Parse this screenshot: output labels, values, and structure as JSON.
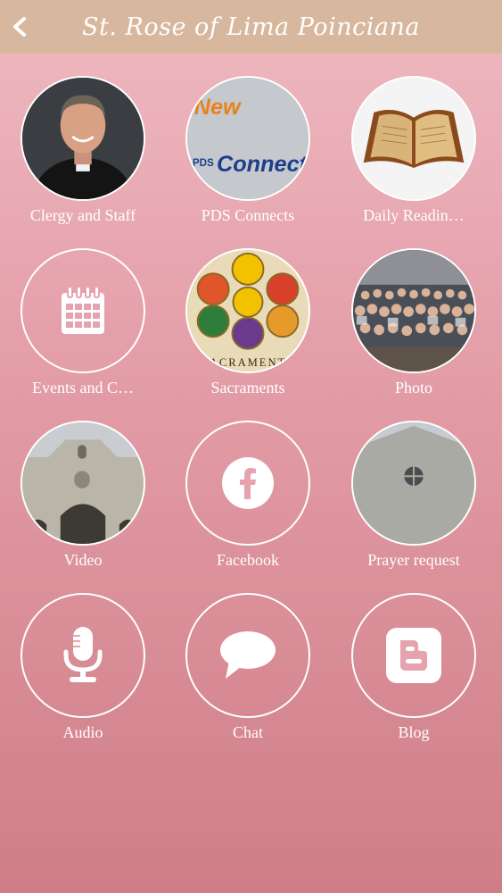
{
  "header": {
    "title": "St. Rose of Lima Poinciana",
    "back_icon": "chevron-left-icon"
  },
  "colors": {
    "header_bg": "#d7b79e",
    "bg_top": "#efb9c1",
    "bg_bottom": "#cf7e88",
    "text": "#ffffff"
  },
  "tiles": [
    {
      "label": "Clergy and Staff",
      "icon": "priest-photo"
    },
    {
      "label": "PDS Connects",
      "icon": "pds-connects-logo",
      "logo_text_1": "New",
      "logo_text_2": "PDS",
      "logo_text_3": "Connects"
    },
    {
      "label": "Daily Readin…",
      "icon": "open-bible-photo"
    },
    {
      "label": "Events and C…",
      "icon": "calendar-icon"
    },
    {
      "label": "Sacraments",
      "icon": "sacraments-image",
      "image_text": "SACRAMENTS"
    },
    {
      "label": "Photo",
      "icon": "congregation-photo"
    },
    {
      "label": "Video",
      "icon": "church-building-photo"
    },
    {
      "label": "Facebook",
      "icon": "facebook-icon"
    },
    {
      "label": "Prayer request",
      "icon": "church-wall-photo"
    },
    {
      "label": "Audio",
      "icon": "microphone-icon"
    },
    {
      "label": "Chat",
      "icon": "chat-bubble-icon"
    },
    {
      "label": "Blog",
      "icon": "blogger-icon"
    }
  ]
}
